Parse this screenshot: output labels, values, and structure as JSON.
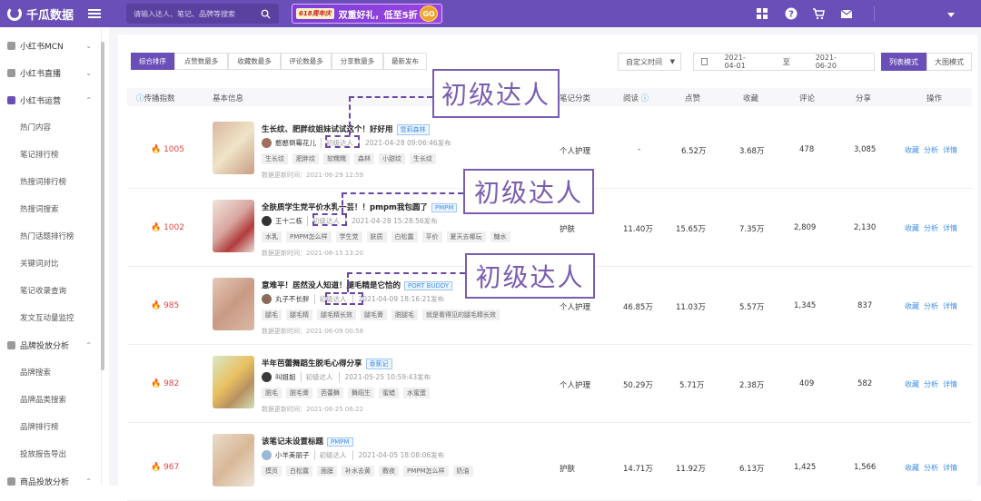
{
  "app": {
    "name": "千瓜数据"
  },
  "search": {
    "placeholder": "请输入达人、笔记、品牌等搜索"
  },
  "promo": {
    "tag": "618周年庆",
    "text": "双重好礼，低至5折",
    "go": "GO"
  },
  "sidebar": {
    "groups": [
      {
        "label": "小红书MCN"
      },
      {
        "label": "小红书直播"
      },
      {
        "label": "小红书运营"
      },
      {
        "label": "品牌投放分析"
      },
      {
        "label": "商品投放分析"
      }
    ],
    "ops_items": [
      "热门内容",
      "笔记排行榜",
      "热搜词排行榜",
      "热搜词搜索",
      "热门话题排行榜",
      "关键词对比",
      "笔记收录查询",
      "发文互动量监控"
    ],
    "brand_items": [
      "品牌搜索",
      "品牌品类搜索",
      "品牌排行榜",
      "投放报告导出"
    ]
  },
  "sort_tabs": [
    "综合排序",
    "点赞数最多",
    "收藏数最多",
    "评论数最多",
    "分享数最多",
    "最新发布"
  ],
  "time_filter": {
    "label": "自定义时间"
  },
  "date_range": {
    "start": "2021-04-01",
    "sep": "至",
    "end": "2021-06-20"
  },
  "view_modes": [
    "列表模式",
    "大图模式"
  ],
  "table": {
    "headers": {
      "rank": "传播指数",
      "info": "基本信息",
      "category": "笔记分类",
      "reads": "阅读",
      "likes": "点赞",
      "favs": "收藏",
      "comments": "评论",
      "shares": "分享",
      "actions": "操作"
    },
    "actions": [
      "收藏",
      "分析",
      "详情"
    ],
    "rows": [
      {
        "score": "1005",
        "title": "生长纹、肥胖纹姐妹试试这个！好好用",
        "brand": "雪莉森林",
        "author": "憨憨倒霉花儿",
        "level": "初级达人",
        "published": "2021-04-28 09:06:46发布",
        "tags": [
          "生长纹",
          "肥胖纹",
          "软糯糯",
          "森林",
          "小甜纹",
          "生长纹"
        ],
        "updated": "数据更新时间：2021-06-29 12:59",
        "category": "个人护理",
        "reads": "-",
        "likes": "6.52万",
        "favs": "3.68万",
        "comments": "478",
        "shares": "3,085"
      },
      {
        "score": "1002",
        "title": "全肤质学生党平价水乳一芸！！pmpm我包圆了",
        "brand": "PMPM",
        "author": "王十二栋",
        "level": "初级达人",
        "published": "2021-04-28 15:28:56发布",
        "tags": [
          "水乳",
          "PMPM怎么样",
          "学生党",
          "肤质",
          "白松露",
          "平价",
          "夏天去哪玩",
          "糖水"
        ],
        "updated": "数据更新时间：2021-06-15 13:20",
        "category": "护肤",
        "reads": "11.40万",
        "likes": "15.65万",
        "favs": "7.35万",
        "comments": "2,809",
        "shares": "2,130"
      },
      {
        "score": "985",
        "title": "意难平！居然没人知道！腿毛精是它恰的",
        "brand": "PORT BUDDY",
        "author": "丸子不长胖",
        "level": "初级达人",
        "published": "2021-04-09 18:16:21发布",
        "tags": [
          "腿毛",
          "腿毛精",
          "腿毛精长效",
          "腿毛膏",
          "脱腿毛",
          "就是看得见的腿毛精长效"
        ],
        "updated": "数据更新时间：2021-06-09 00:58",
        "category": "个人护理",
        "reads": "46.85万",
        "likes": "11.03万",
        "favs": "5.57万",
        "comments": "1,345",
        "shares": "837"
      },
      {
        "score": "982",
        "title": "半年芭蕾舞蹈生脱毛心得分享",
        "brand": "香蕉记",
        "author": "叫姐姐",
        "level": "初级达人",
        "published": "2021-05-25 10:59:43发布",
        "tags": [
          "脱毛",
          "脱毛膏",
          "芭蕾舞",
          "舞蹈生",
          "蜜蜡",
          "水蜜蛋"
        ],
        "updated": "数据更新时间：2021-06-25 06:22",
        "category": "个人护理",
        "reads": "50.29万",
        "likes": "5.71万",
        "favs": "2.38万",
        "comments": "409",
        "shares": "582"
      },
      {
        "score": "967",
        "title": "该笔记未设置标题",
        "brand": "PMPM",
        "author": "小羊美丽子",
        "level": "初级达人",
        "published": "2021-04-05 18:08:06发布",
        "tags": [
          "摸页",
          "白松露",
          "面膜",
          "补水去黄",
          "敷夜",
          "PMPM怎么样",
          "奶油"
        ],
        "updated": "",
        "category": "护肤",
        "reads": "14.71万",
        "likes": "11.92万",
        "favs": "6.13万",
        "comments": "1,425",
        "shares": "1,566"
      }
    ]
  },
  "callouts": [
    "初级达人",
    "初级达人",
    "初级达人"
  ],
  "colors": {
    "brand": "#6a4fb8",
    "link": "#3f8ee8",
    "flame": "#e64545",
    "callout": "#7a5db0"
  }
}
